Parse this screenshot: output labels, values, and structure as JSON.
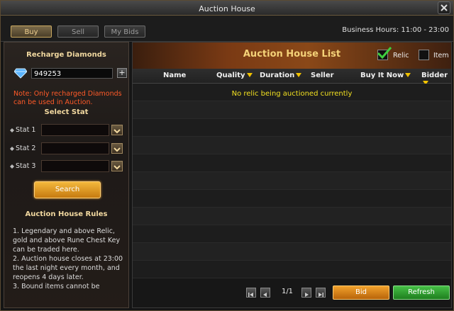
{
  "window": {
    "title": "Auction House"
  },
  "tabs": [
    {
      "label": "Buy",
      "active": true
    },
    {
      "label": "Sell",
      "active": false
    },
    {
      "label": "My Bids",
      "active": false
    }
  ],
  "business_hours": "Business Hours: 11:00 - 23:00",
  "left_panel": {
    "recharge_title": "Recharge Diamonds",
    "diamonds": "949253",
    "note": "Note: Only recharged Diamonds can be used in Auction.",
    "select_stat_title": "Select Stat",
    "stats": [
      {
        "label": "Stat 1",
        "value": ""
      },
      {
        "label": "Stat 2",
        "value": ""
      },
      {
        "label": "Stat 3",
        "value": ""
      }
    ],
    "search_label": "Search",
    "rules_title": "Auction House Rules",
    "rules": [
      "1. Legendary and above Relic, gold and above Rune Chest Key can be traded here.",
      "2. Auction house closes at 23:00 the last night every month, and reopens 4 days later.",
      "3. Bound items cannot be"
    ]
  },
  "list": {
    "title": "Auction House List",
    "filters": [
      {
        "label": "Relic",
        "checked": true
      },
      {
        "label": "Item",
        "checked": false
      }
    ],
    "columns": [
      "Name",
      "Quality",
      "Duration",
      "Seller",
      "Buy It Now",
      "Bidder"
    ],
    "empty_message": "No relic being auctioned currently",
    "page": "1/1",
    "bid_label": "Bid",
    "refresh_label": "Refresh"
  },
  "colors": {
    "accent": "#f4d278",
    "note": "#ff5a28",
    "empty_message": "#f2e020",
    "bid_button": "#e08a1c",
    "refresh_button": "#2fa02f"
  }
}
